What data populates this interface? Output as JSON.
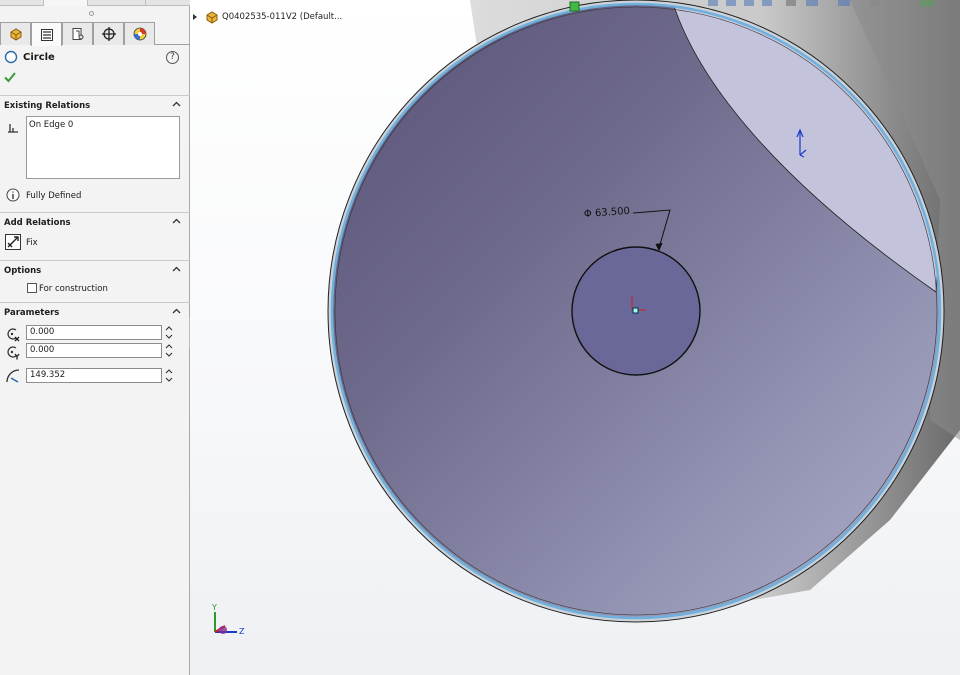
{
  "feature_tree": {
    "root_label": "Q0402535-011V2  (Default..."
  },
  "property_manager": {
    "title": "Circle",
    "help_symbol": "?",
    "tabs": [
      "feature-manager-tab",
      "property-manager-tab",
      "configuration-manager-tab",
      "dimxpert-manager-tab",
      "display-manager-tab"
    ],
    "existing_relations": {
      "header": "Existing Relations",
      "items": [
        "On Edge 0"
      ],
      "status": "Fully Defined"
    },
    "add_relations": {
      "header": "Add Relations",
      "fix_label": "Fix"
    },
    "options": {
      "header": "Options",
      "for_construction_label": "For construction",
      "for_construction_checked": false
    },
    "parameters": {
      "header": "Parameters",
      "center_x": "0.000",
      "center_y": "0.000",
      "radius": "149.352"
    }
  },
  "graphics": {
    "dimension_label": "Φ 63.500",
    "triad": {
      "y_label": "Y",
      "z_label": "Z"
    }
  },
  "colors": {
    "panel_bg": "#f3f3f3",
    "face_dark": "#5a5478",
    "face_light": "#a8a8c6",
    "edge_highlight": "#6fb0dc",
    "check_green": "#3a9a3a"
  }
}
